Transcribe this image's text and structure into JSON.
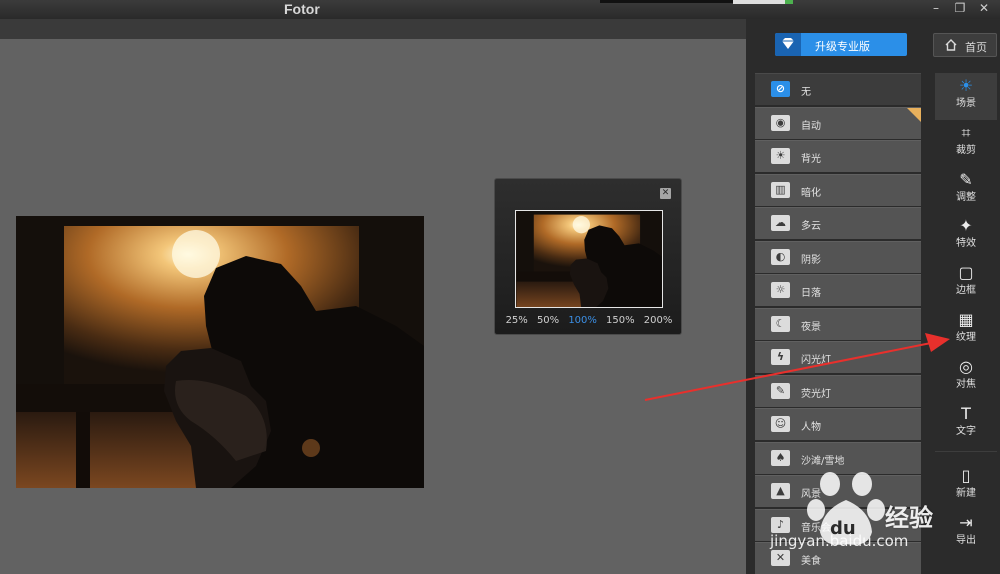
{
  "titlebar": {
    "title": "Fotor",
    "minimize_glyph": "–",
    "restore_glyph": "❐",
    "close_glyph": "✕"
  },
  "navigator": {
    "close_glyph": "✕",
    "zoom_options": [
      "25%",
      "50%",
      "100%",
      "150%",
      "200%"
    ],
    "active_zoom": "100%"
  },
  "header": {
    "upgrade_label": "升级专业版",
    "home_label": "首页"
  },
  "scenes": [
    {
      "label": "无",
      "icon": "none-icon",
      "glyph": "⊘",
      "active": true
    },
    {
      "label": "自动",
      "icon": "camera-icon",
      "glyph": "◉"
    },
    {
      "label": "背光",
      "icon": "backlight-icon",
      "glyph": "☀"
    },
    {
      "label": "暗化",
      "icon": "darken-icon",
      "glyph": "▥"
    },
    {
      "label": "多云",
      "icon": "cloud-icon",
      "glyph": "☁"
    },
    {
      "label": "阴影",
      "icon": "shadow-icon",
      "glyph": "◐"
    },
    {
      "label": "日落",
      "icon": "sunset-icon",
      "glyph": "☼"
    },
    {
      "label": "夜景",
      "icon": "night-icon",
      "glyph": "☾"
    },
    {
      "label": "闪光灯",
      "icon": "flash-icon",
      "glyph": "ϟ"
    },
    {
      "label": "荧光灯",
      "icon": "fluorescent-icon",
      "glyph": "✎"
    },
    {
      "label": "人物",
      "icon": "portrait-icon",
      "glyph": "☺"
    },
    {
      "label": "沙滩/雪地",
      "icon": "beach-icon",
      "glyph": "♠"
    },
    {
      "label": "风景",
      "icon": "landscape-icon",
      "glyph": "▲"
    },
    {
      "label": "音乐会",
      "icon": "concert-icon",
      "glyph": "♪"
    },
    {
      "label": "美食",
      "icon": "food-icon",
      "glyph": "✕"
    }
  ],
  "tools": [
    {
      "label": "场景",
      "icon": "scene-icon",
      "glyph": "☀",
      "active": true
    },
    {
      "label": "裁剪",
      "icon": "crop-icon",
      "glyph": "⌗"
    },
    {
      "label": "调整",
      "icon": "adjust-pencil-icon",
      "glyph": "✎"
    },
    {
      "label": "特效",
      "icon": "effects-sparkle-icon",
      "glyph": "✦"
    },
    {
      "label": "边框",
      "icon": "frame-icon",
      "glyph": "▢"
    },
    {
      "label": "纹理",
      "icon": "texture-icon",
      "glyph": "▦"
    },
    {
      "label": "对焦",
      "icon": "focus-icon",
      "glyph": "◎"
    },
    {
      "label": "文字",
      "icon": "text-icon",
      "glyph": "T"
    }
  ],
  "file_tools": [
    {
      "label": "新建",
      "icon": "new-file-icon",
      "glyph": "▯"
    },
    {
      "label": "导出",
      "icon": "export-icon",
      "glyph": "⇥"
    }
  ],
  "watermark": {
    "brand": "经验",
    "url": "jingyan.baidu.com"
  },
  "colors": {
    "accent": "#2b8fe8",
    "annotation_arrow": "#e8302c",
    "canvas_bg": "#626262"
  }
}
